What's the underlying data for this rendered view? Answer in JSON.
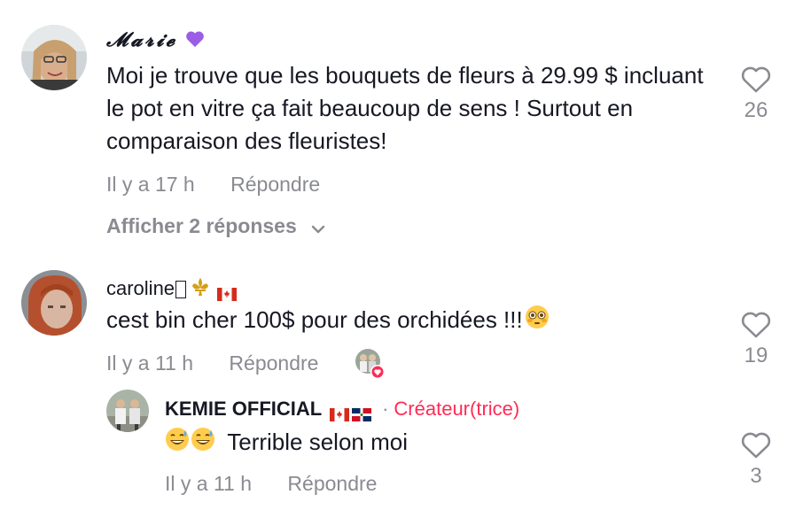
{
  "comments": [
    {
      "username": "𝓜𝓪𝓻𝓲𝓮",
      "text": "Moi je trouve que les bouquets de fleurs à 29.99 $ incluant le pot en vitre ça fait beaucoup de sens ! Surtout en comparaison des fleuristes!",
      "time": "Il y a 17 h",
      "reply_label": "Répondre",
      "likes": "26",
      "view_replies": "Afficher 2 réponses"
    },
    {
      "username": "caroline",
      "text": "cest bin cher 100$ pour des orchidées !!!",
      "time": "Il y a 11 h",
      "reply_label": "Répondre",
      "likes": "19",
      "replies": [
        {
          "username": "KEMIE OFFICIAL",
          "badge": "Créateur(trice)",
          "separator": "·",
          "text": "Terrible selon moi",
          "time": "Il y a 11 h",
          "reply_label": "Répondre",
          "likes": "3"
        }
      ]
    }
  ],
  "colors": {
    "text": "#161823",
    "muted": "#8a8b91",
    "creator_badge": "#fe2c55",
    "heart_icon": "#8a8b91"
  },
  "icons": [
    "heart-icon",
    "chevron-down-icon",
    "purple-heart-icon",
    "fleur-de-lis-icon",
    "canada-flag-icon",
    "dominican-flag-icon",
    "flushed-face-icon",
    "grinning-sweat-icon",
    "liked-by-creator-icon"
  ]
}
